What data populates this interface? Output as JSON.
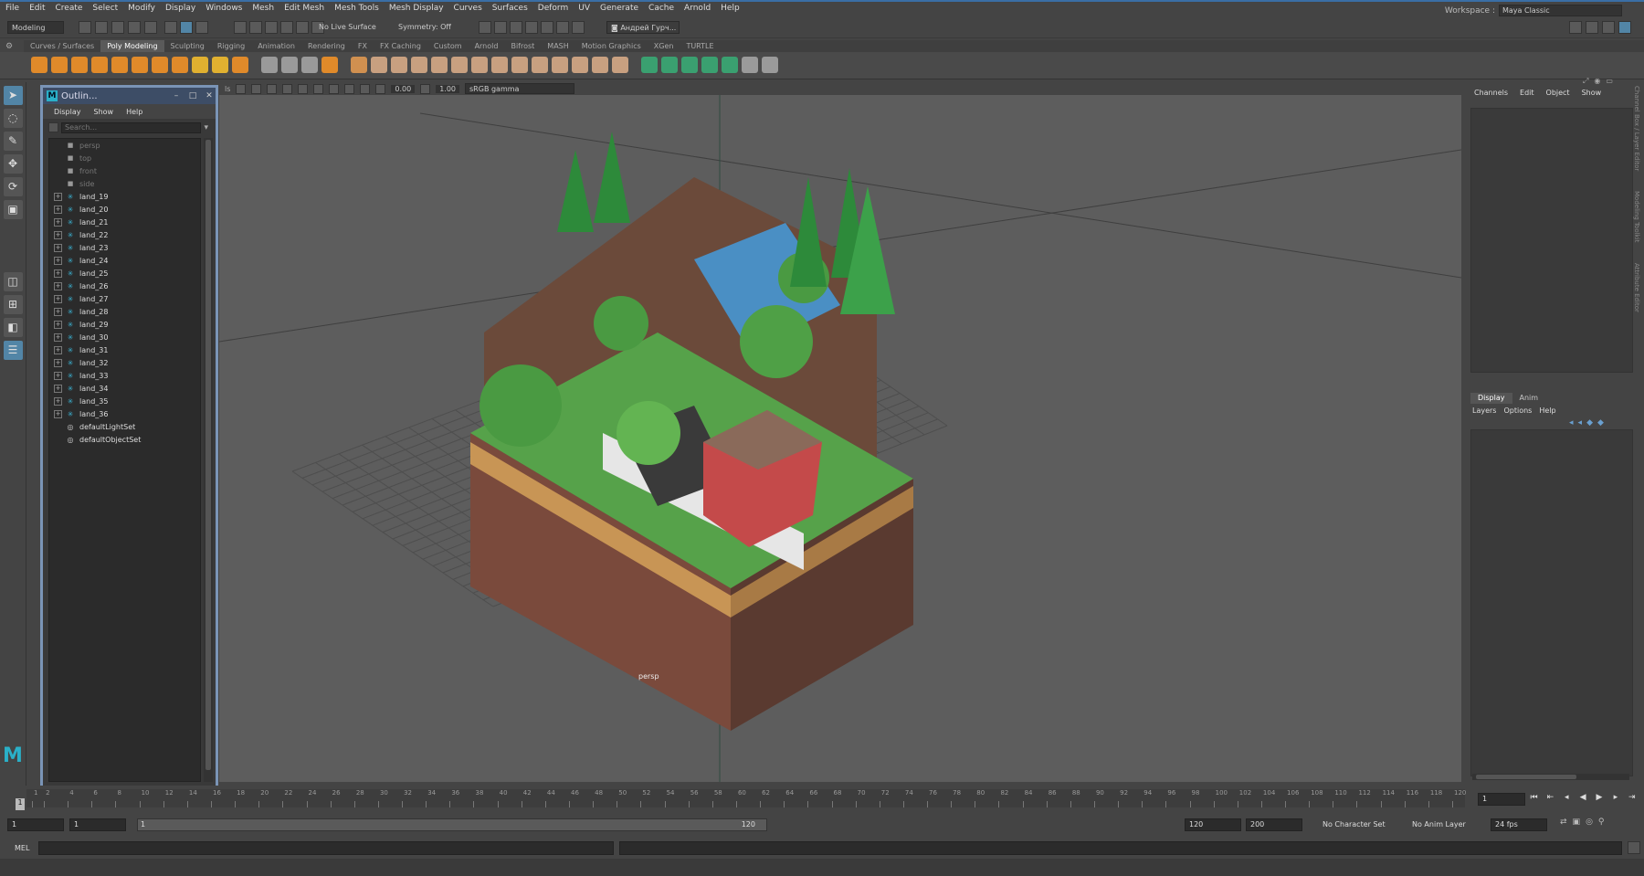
{
  "menubar": {
    "items": [
      "File",
      "Edit",
      "Create",
      "Select",
      "Modify",
      "Display",
      "Windows",
      "Mesh",
      "Edit Mesh",
      "Mesh Tools",
      "Mesh Display",
      "Curves",
      "Surfaces",
      "Deform",
      "UV",
      "Generate",
      "Cache",
      "Arnold",
      "Help"
    ],
    "workspace_label": "Workspace :",
    "workspace_value": "Maya Classic"
  },
  "statusline": {
    "mode": "Modeling",
    "live_surface": "No Live Surface",
    "symmetry": "Symmetry: Off",
    "user": "Андрей Гурч..."
  },
  "shelf": {
    "tabs": [
      "Curves / Surfaces",
      "Poly Modeling",
      "Sculpting",
      "Rigging",
      "Animation",
      "Rendering",
      "FX",
      "FX Caching",
      "Custom",
      "Arnold",
      "Bifrost",
      "MASH",
      "Motion Graphics",
      "XGen",
      "TURTLE"
    ],
    "active_tab": "Poly Modeling"
  },
  "outliner": {
    "title": "Outlin...",
    "menu": [
      "Display",
      "Show",
      "Help"
    ],
    "search_placeholder": "Search...",
    "cameras": [
      "persp",
      "top",
      "front",
      "side"
    ],
    "items": [
      "land_19",
      "land_20",
      "land_21",
      "land_22",
      "land_23",
      "land_24",
      "land_25",
      "land_26",
      "land_27",
      "land_28",
      "land_29",
      "land_30",
      "land_31",
      "land_32",
      "land_33",
      "land_34",
      "land_35",
      "land_36"
    ],
    "sets": [
      "defaultLightSet",
      "defaultObjectSet"
    ]
  },
  "viewport": {
    "camera_label": "persp",
    "exposure": "0.00",
    "gamma": "1.00",
    "color_space": "sRGB gamma",
    "panel_corner": "ls"
  },
  "channelbox": {
    "menu": [
      "Channels",
      "Edit",
      "Object",
      "Show"
    ]
  },
  "layereditor": {
    "tabs": [
      "Display",
      "Anim"
    ],
    "active": "Display",
    "menu": [
      "Layers",
      "Options",
      "Help"
    ]
  },
  "side_tabs": [
    "Channel Box / Layer Editor",
    "Modeling Toolkit",
    "Attribute Editor"
  ],
  "timeline": {
    "ticks": [
      "1",
      "2",
      "4",
      "6",
      "8",
      "10",
      "12",
      "14",
      "16",
      "18",
      "20",
      "22",
      "24",
      "26",
      "28",
      "30",
      "32",
      "34",
      "36",
      "38",
      "40",
      "42",
      "44",
      "46",
      "48",
      "50",
      "52",
      "54",
      "56",
      "58",
      "60",
      "62",
      "64",
      "66",
      "68",
      "70",
      "72",
      "74",
      "76",
      "78",
      "80",
      "82",
      "84",
      "86",
      "88",
      "90",
      "92",
      "94",
      "96",
      "98",
      "100",
      "102",
      "104",
      "106",
      "108",
      "110",
      "112",
      "114",
      "116",
      "118",
      "120"
    ],
    "current_frame": "1"
  },
  "range": {
    "start": "1",
    "playback_start": "1",
    "slider_start": "1",
    "slider_end": "120",
    "playback_end": "120",
    "end": "200",
    "character_set": "No Character Set",
    "anim_layer": "No Anim Layer",
    "fps": "24 fps"
  },
  "cmdline": {
    "label": "MEL"
  }
}
